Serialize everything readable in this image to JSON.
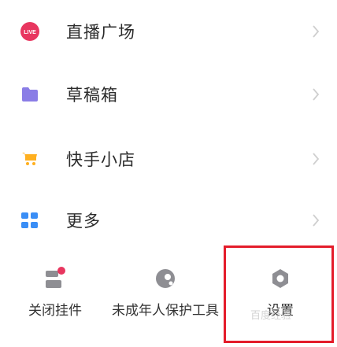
{
  "menu": {
    "items": [
      {
        "label": "直播广场",
        "icon": "live-icon"
      },
      {
        "label": "草稿箱",
        "icon": "folder-icon"
      },
      {
        "label": "快手小店",
        "icon": "cart-icon"
      },
      {
        "label": "更多",
        "icon": "grid-icon"
      }
    ]
  },
  "tools": [
    {
      "label": "关闭挂件",
      "icon": "widget-icon"
    },
    {
      "label": "未成年人保护工具",
      "icon": "shield-face-icon"
    },
    {
      "label": "设置",
      "icon": "settings-icon"
    }
  ],
  "watermark": "百度经验",
  "colors": {
    "live_red": "#e8365f",
    "folder_purple": "#8a7de6",
    "cart_orange": "#ffb020",
    "grid_blue": "#3a8ef6",
    "icon_gray": "#8e8e93",
    "highlight": "#e41c2a"
  }
}
